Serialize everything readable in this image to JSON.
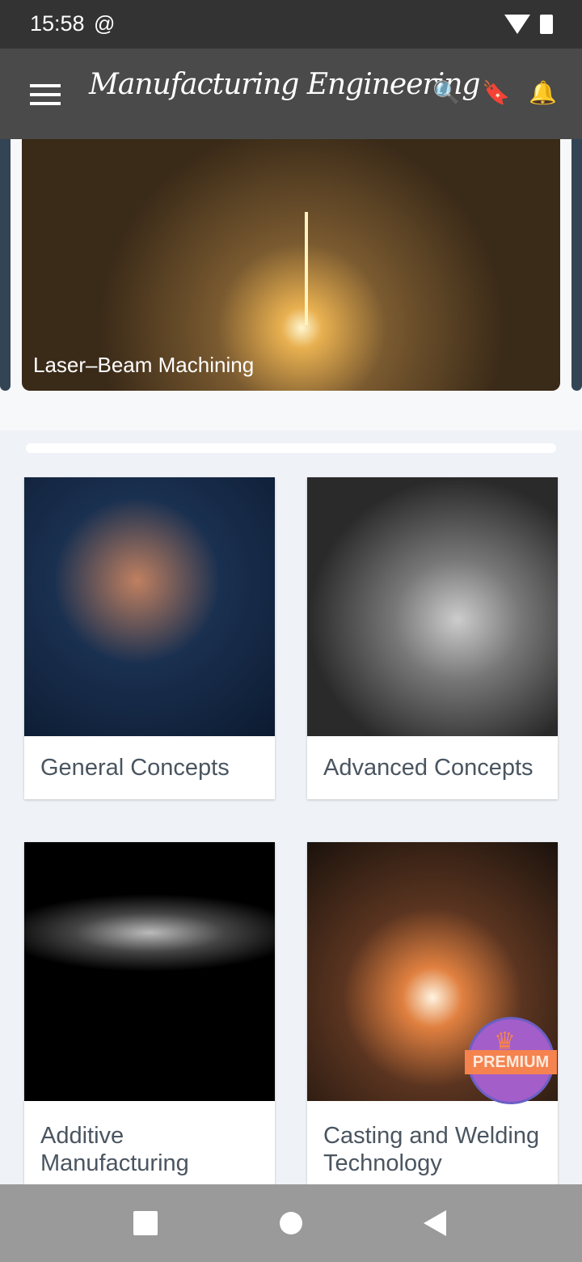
{
  "status": {
    "time": "15:58"
  },
  "appbar": {
    "title": "Manufacturing Engineering",
    "icons": [
      "menu-icon",
      "search-icon",
      "bookmark-icon",
      "bell-icon"
    ]
  },
  "carousel": {
    "caption": "Laser–Beam Machining"
  },
  "cards": [
    {
      "label": "General Concepts"
    },
    {
      "label": "Advanced Concepts"
    },
    {
      "label": "Additive Manufacturing"
    },
    {
      "label": "Casting and Welding Technology"
    }
  ],
  "premium": {
    "label": "PREMIUM"
  }
}
